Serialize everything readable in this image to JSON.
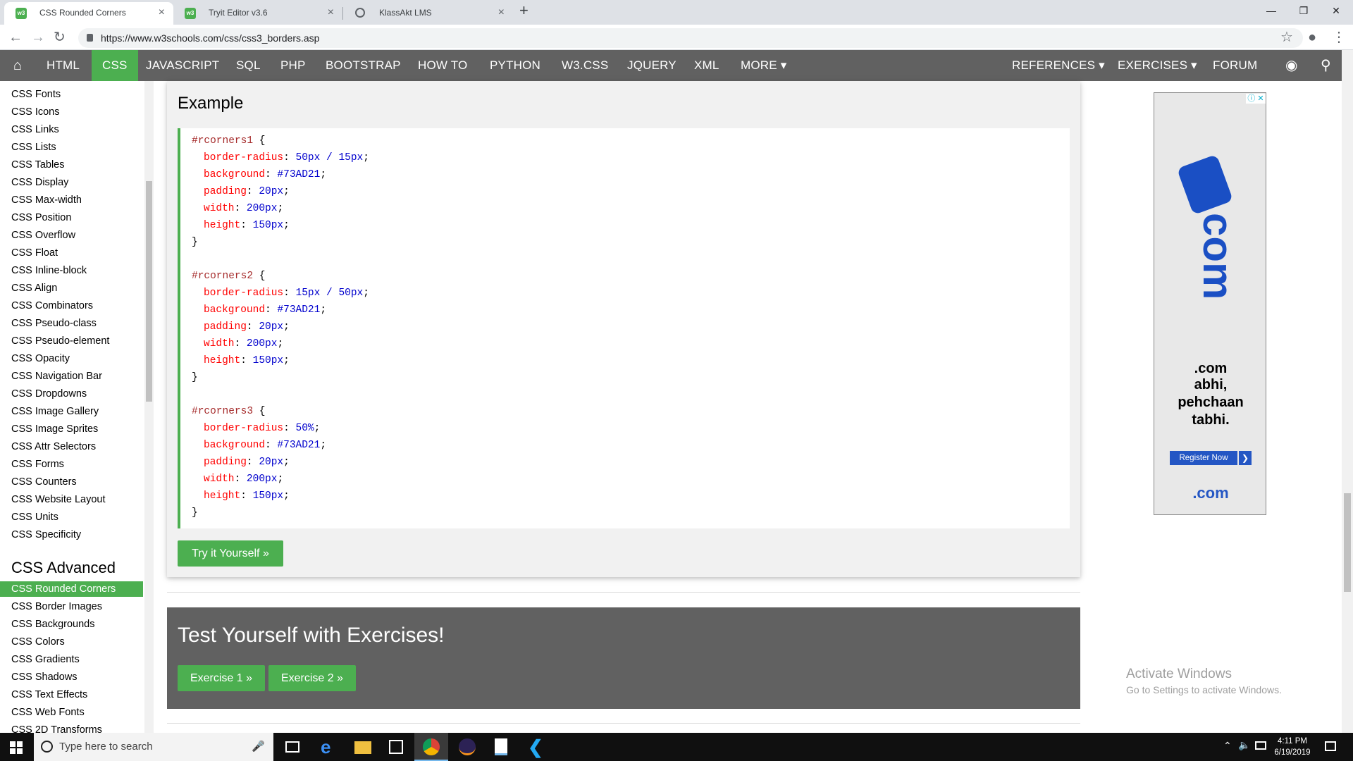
{
  "browser": {
    "tabs": [
      {
        "title": "CSS Rounded Corners",
        "active": true
      },
      {
        "title": "Tryit Editor v3.6",
        "active": false
      },
      {
        "title": "KlassAkt LMS",
        "active": false
      }
    ],
    "url": "https://www.w3schools.com/css/css3_borders.asp"
  },
  "topnav": {
    "items": [
      "HTML",
      "CSS",
      "JAVASCRIPT",
      "SQL",
      "PHP",
      "BOOTSTRAP",
      "HOW TO",
      "PYTHON",
      "W3.CSS",
      "JQUERY",
      "XML",
      "MORE ▾"
    ],
    "right": [
      "REFERENCES ▾",
      "EXERCISES ▾",
      "FORUM"
    ],
    "active": "CSS"
  },
  "sidebar": {
    "items": [
      "CSS Fonts",
      "CSS Icons",
      "CSS Links",
      "CSS Lists",
      "CSS Tables",
      "CSS Display",
      "CSS Max-width",
      "CSS Position",
      "CSS Overflow",
      "CSS Float",
      "CSS Inline-block",
      "CSS Align",
      "CSS Combinators",
      "CSS Pseudo-class",
      "CSS Pseudo-element",
      "CSS Opacity",
      "CSS Navigation Bar",
      "CSS Dropdowns",
      "CSS Image Gallery",
      "CSS Image Sprites",
      "CSS Attr Selectors",
      "CSS Forms",
      "CSS Counters",
      "CSS Website Layout",
      "CSS Units",
      "CSS Specificity"
    ],
    "advanced_heading": "CSS Advanced",
    "advanced_items": [
      "CSS Rounded Corners",
      "CSS Border Images",
      "CSS Backgrounds",
      "CSS Colors",
      "CSS Gradients",
      "CSS Shadows",
      "CSS Text Effects",
      "CSS Web Fonts",
      "CSS 2D Transforms"
    ],
    "active": "CSS Rounded Corners"
  },
  "example": {
    "title": "Example",
    "blocks": [
      {
        "selector": "#rcorners1",
        "props": [
          [
            "border-radius",
            "50px / 15px"
          ],
          [
            "background",
            "#73AD21"
          ],
          [
            "padding",
            "20px"
          ],
          [
            "width",
            "200px"
          ],
          [
            "height",
            "150px"
          ]
        ]
      },
      {
        "selector": "#rcorners2",
        "props": [
          [
            "border-radius",
            "15px / 50px"
          ],
          [
            "background",
            "#73AD21"
          ],
          [
            "padding",
            "20px"
          ],
          [
            "width",
            "200px"
          ],
          [
            "height",
            "150px"
          ]
        ]
      },
      {
        "selector": "#rcorners3",
        "props": [
          [
            "border-radius",
            "50%"
          ],
          [
            "background",
            "#73AD21"
          ],
          [
            "padding",
            "20px"
          ],
          [
            "width",
            "200px"
          ],
          [
            "height",
            "150px"
          ]
        ]
      }
    ],
    "try_button": "Try it Yourself »"
  },
  "exercises": {
    "title": "Test Yourself with Exercises!",
    "buttons": [
      "Exercise 1 »",
      "Exercise 2 »"
    ]
  },
  "ad": {
    "lines": [
      ".com",
      "abhi,",
      "pehchaan",
      "tabhi."
    ],
    "big": "com",
    "button": "Register Now",
    "logo": ".com"
  },
  "watermark": {
    "line1": "Activate Windows",
    "line2": "Go to Settings to activate Windows."
  },
  "taskbar": {
    "search_placeholder": "Type here to search",
    "time": "4:11 PM",
    "date": "6/19/2019"
  },
  "colors": {
    "green": "#4caf50",
    "nav": "#616161"
  }
}
